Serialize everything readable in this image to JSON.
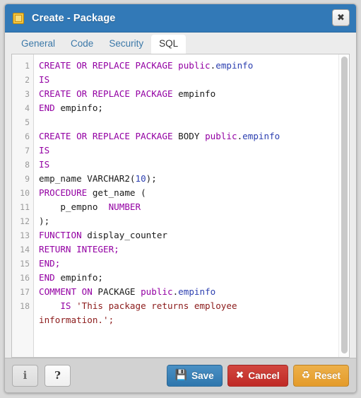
{
  "window": {
    "title": "Create - Package",
    "icon": "package-icon",
    "close_label": "✖"
  },
  "tabs": [
    {
      "label": "General",
      "active": false
    },
    {
      "label": "Code",
      "active": false
    },
    {
      "label": "Security",
      "active": false
    },
    {
      "label": "SQL",
      "active": true
    }
  ],
  "editor": {
    "line_numbers": [
      "1",
      "2",
      "3",
      "4",
      "5",
      "6",
      "7",
      "8",
      "9",
      "10",
      "11",
      "12",
      "13",
      "14",
      "15",
      "16",
      "17",
      "18",
      ""
    ],
    "lines": [
      [
        {
          "t": "CREATE OR REPLACE PACKAGE ",
          "c": "kw"
        },
        {
          "t": "public",
          "c": "kw"
        },
        {
          "t": ".",
          "c": "pln"
        },
        {
          "t": "empinfo",
          "c": "id"
        }
      ],
      [
        {
          "t": "IS",
          "c": "kw"
        }
      ],
      [
        {
          "t": "CREATE OR REPLACE PACKAGE ",
          "c": "kw"
        },
        {
          "t": "empinfo",
          "c": "pln"
        }
      ],
      [
        {
          "t": "END",
          "c": "kw"
        },
        {
          "t": " empinfo;",
          "c": "pln"
        }
      ],
      [
        {
          "t": "",
          "c": "pln"
        }
      ],
      [
        {
          "t": "CREATE OR REPLACE PACKAGE ",
          "c": "kw"
        },
        {
          "t": "BODY ",
          "c": "pln"
        },
        {
          "t": "public",
          "c": "kw"
        },
        {
          "t": ".",
          "c": "pln"
        },
        {
          "t": "empinfo",
          "c": "id"
        }
      ],
      [
        {
          "t": "IS",
          "c": "kw"
        }
      ],
      [
        {
          "t": "IS",
          "c": "kw"
        }
      ],
      [
        {
          "t": "emp_name VARCHAR2(",
          "c": "pln"
        },
        {
          "t": "10",
          "c": "num"
        },
        {
          "t": ");",
          "c": "pln"
        }
      ],
      [
        {
          "t": "PROCEDURE",
          "c": "kw"
        },
        {
          "t": " get_name (",
          "c": "pln"
        }
      ],
      [
        {
          "t": "    p_empno  ",
          "c": "pln"
        },
        {
          "t": "NUMBER",
          "c": "kw"
        }
      ],
      [
        {
          "t": ");",
          "c": "pln"
        }
      ],
      [
        {
          "t": "FUNCTION",
          "c": "kw"
        },
        {
          "t": " display_counter",
          "c": "pln"
        }
      ],
      [
        {
          "t": "RETURN INTEGER;",
          "c": "kw"
        }
      ],
      [
        {
          "t": "END;",
          "c": "kw"
        }
      ],
      [
        {
          "t": "END",
          "c": "kw"
        },
        {
          "t": " empinfo;",
          "c": "pln"
        }
      ],
      [
        {
          "t": "COMMENT ON ",
          "c": "kw"
        },
        {
          "t": "PACKAGE ",
          "c": "pln"
        },
        {
          "t": "public",
          "c": "kw"
        },
        {
          "t": ".",
          "c": "pln"
        },
        {
          "t": "empinfo",
          "c": "id"
        }
      ],
      [
        {
          "t": "    IS ",
          "c": "kw"
        },
        {
          "t": "'This package returns employee",
          "c": "str"
        }
      ],
      [
        {
          "t": "information.';",
          "c": "str"
        }
      ]
    ]
  },
  "footer": {
    "info_label": "i",
    "help_label": "?",
    "buttons": [
      {
        "label": "Save",
        "glyph": "💾",
        "style": "save"
      },
      {
        "label": "Cancel",
        "glyph": "✖",
        "style": "cancel"
      },
      {
        "label": "Reset",
        "glyph": "♻",
        "style": "reset"
      }
    ]
  },
  "colors": {
    "titlebar": "#3279b7",
    "keyword": "#9300a3",
    "identifier": "#2c3fb0",
    "string": "#8b1a1a",
    "save": "#2e76ad",
    "cancel": "#bf2a26",
    "reset": "#e49b2a"
  }
}
